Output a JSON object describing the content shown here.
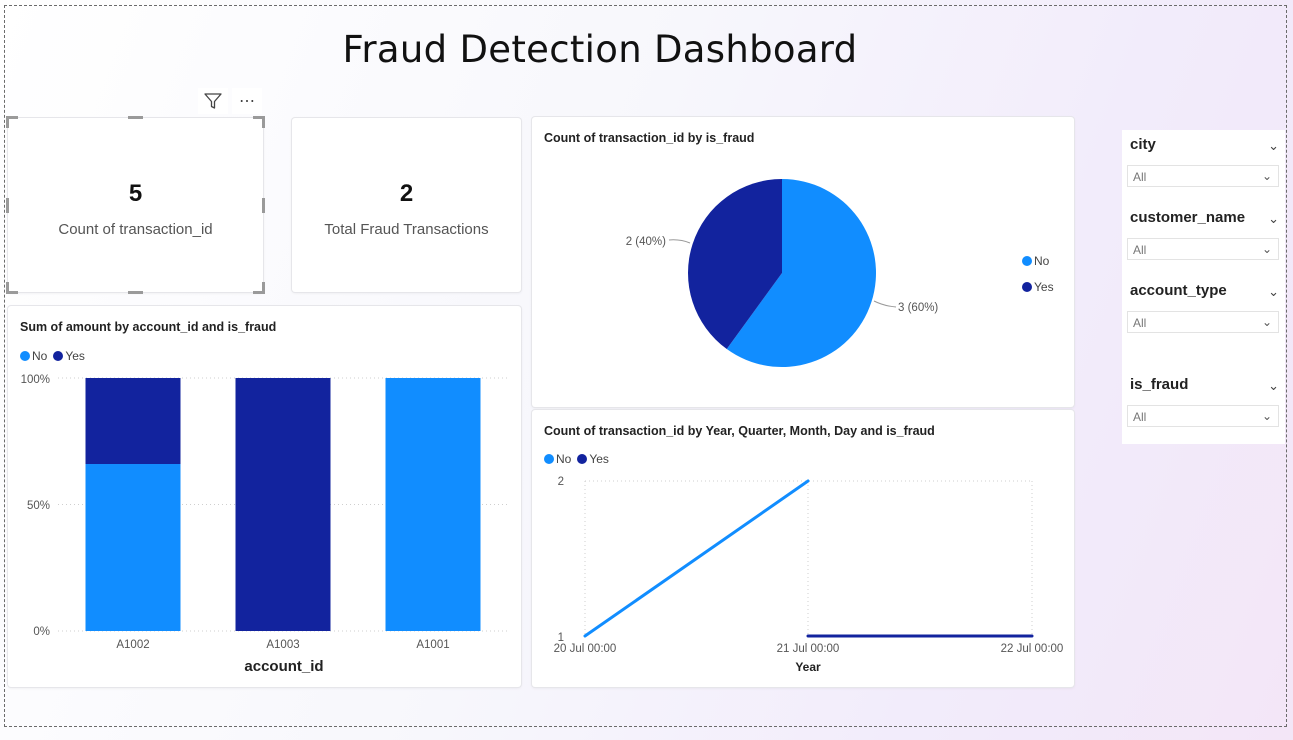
{
  "title": "Fraud Detection Dashboard",
  "colors": {
    "no": "#118DFF",
    "yes": "#12239E",
    "grid": "#cfcfcf"
  },
  "toolbar": {
    "filter_icon": "filter-icon",
    "more_icon": "more-options-icon",
    "more_glyph": "⋯"
  },
  "kpis": [
    {
      "value": "5",
      "label": "Count of transaction_id"
    },
    {
      "value": "2",
      "label": "Total Fraud Transactions"
    }
  ],
  "bar_chart": {
    "title": "Sum of amount by account_id and is_fraud",
    "legend": [
      "No",
      "Yes"
    ],
    "xlabel": "account_id",
    "ticks": [
      "100%",
      "50%",
      "0%"
    ]
  },
  "pie_chart": {
    "title": "Count of transaction_id by is_fraud",
    "legend": [
      "No",
      "Yes"
    ],
    "labels": [
      "2 (40%)",
      "3 (60%)"
    ]
  },
  "line_chart": {
    "title": "Count of transaction_id by Year, Quarter, Month, Day and is_fraud",
    "legend": [
      "No",
      "Yes"
    ],
    "xlabel": "Year",
    "yticks": [
      "2",
      "1"
    ],
    "xticks": [
      "20 Jul 00:00",
      "21 Jul 00:00",
      "22 Jul 00:00"
    ]
  },
  "slicers": [
    {
      "title": "city",
      "value": "All"
    },
    {
      "title": "customer_name",
      "value": "All"
    },
    {
      "title": "account_type",
      "value": "All"
    },
    {
      "title": "is_fraud",
      "value": "All"
    }
  ],
  "chart_data": [
    {
      "type": "bar",
      "title": "Sum of amount by account_id and is_fraud",
      "xlabel": "account_id",
      "ylabel": "",
      "stacked": "100%",
      "categories": [
        "A1002",
        "A1003",
        "A1001"
      ],
      "series": [
        {
          "name": "No",
          "values": [
            66,
            0,
            100
          ]
        },
        {
          "name": "Yes",
          "values": [
            34,
            100,
            0
          ]
        }
      ],
      "ylim": [
        0,
        100
      ],
      "grid": true,
      "legend": "top-left"
    },
    {
      "type": "pie",
      "title": "Count of transaction_id by is_fraud",
      "categories": [
        "No",
        "Yes"
      ],
      "values": [
        3,
        2
      ],
      "legend": "right"
    },
    {
      "type": "line",
      "title": "Count of transaction_id by Year, Quarter, Month, Day and is_fraud",
      "xlabel": "Year",
      "ylabel": "",
      "series": [
        {
          "name": "No",
          "x": [
            "2024-07-20",
            "2024-07-21"
          ],
          "values": [
            1,
            2
          ]
        },
        {
          "name": "Yes",
          "x": [
            "2024-07-21",
            "2024-07-22"
          ],
          "values": [
            1,
            1
          ]
        }
      ],
      "ylim": [
        1,
        2
      ],
      "grid": true,
      "legend": "top-left"
    }
  ]
}
